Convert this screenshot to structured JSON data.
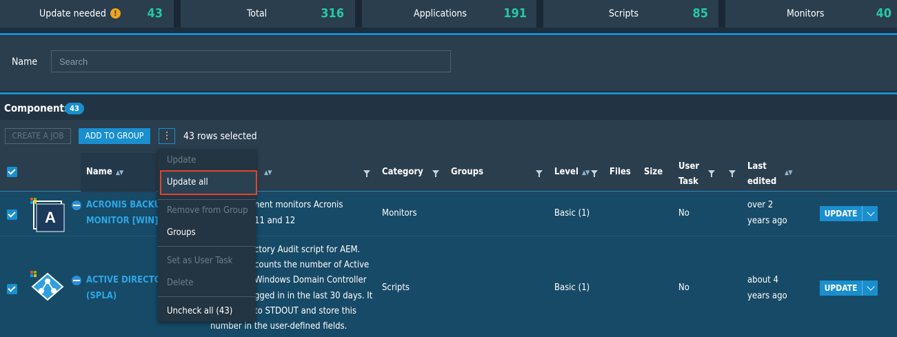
{
  "stats": [
    {
      "label": "Update needed",
      "value": "43",
      "warning": "!"
    },
    {
      "label": "Total",
      "value": "316"
    },
    {
      "label": "Applications",
      "value": "191"
    },
    {
      "label": "Scripts",
      "value": "85"
    },
    {
      "label": "Monitors",
      "value": "40"
    }
  ],
  "filter": {
    "name_label": "Name",
    "search_placeholder": "Search"
  },
  "components": {
    "title": "Components",
    "count": "43",
    "create_job": "CREATE A JOB",
    "add_to_group": "ADD TO GROUP",
    "more": "⋮",
    "rows_selected": "43 rows selected"
  },
  "table": {
    "headers": {
      "name": "Name",
      "category": "Category",
      "groups": "Groups",
      "level": "Level",
      "files": "Files",
      "size": "Size",
      "user_task_1": "User",
      "user_task_2": "Task",
      "last_edited_1": "Last",
      "last_edited_2": "edited"
    },
    "rows": [
      {
        "name_1": "ACRONIS BACKUP",
        "name_2": "MONITOR [WIN]",
        "desc_1": "nent monitors Acronis",
        "desc_2": "11 and 12",
        "category": "Monitors",
        "level": "Basic (1)",
        "user_task": "No",
        "last_edited_1": "over 2",
        "last_edited_2": "years ago",
        "action": "UPDATE"
      },
      {
        "name_1": "ACTIVE DIRECTORY",
        "name_2": "(SPLA)",
        "desc_1": "ctory Audit script for AEM.",
        "desc_2": "counts the number of Active",
        "desc_3": "Windows Domain Controller",
        "desc_4": "gged in in the last 30 days. It",
        "desc_5": "to STDOUT and store this",
        "desc_6": "number in the user-defined fields.",
        "category": "Scripts",
        "level": "Basic (1)",
        "user_task": "No",
        "last_edited_1": "about 4",
        "last_edited_2": "years ago",
        "action": "UPDATE"
      }
    ]
  },
  "menu": {
    "update": "Update",
    "update_all": "Update all",
    "remove_from_group": "Remove from Group",
    "groups": "Groups",
    "set_as_user_task": "Set as User Task",
    "delete": "Delete",
    "uncheck_all": "Uncheck all (43)"
  },
  "colors": {
    "accent": "#1a8fcf",
    "stat_value": "#23c9a6",
    "highlight": "#e2452b",
    "warning": "#f0a31d"
  }
}
